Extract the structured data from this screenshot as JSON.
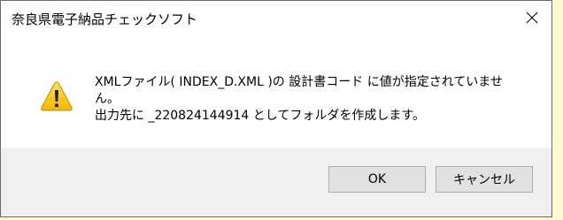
{
  "window": {
    "title": "奈良県電子納品チェックソフト"
  },
  "message": {
    "lines": [
      "XMLファイル( INDEX_D.XML )の 設計書コード に値が指定されていませ",
      "ん。",
      "出力先に _220824144914 としてフォルダを作成します。"
    ]
  },
  "buttons": {
    "ok_label": "OK",
    "cancel_label": "キャンセル"
  },
  "icons": {
    "warning": "warning-icon",
    "close": "close-icon"
  },
  "colors": {
    "background": "#fff9d0",
    "footer": "#f0f0f0",
    "warning_fill": "#f7c800",
    "button_face": "#e1e1e1"
  }
}
